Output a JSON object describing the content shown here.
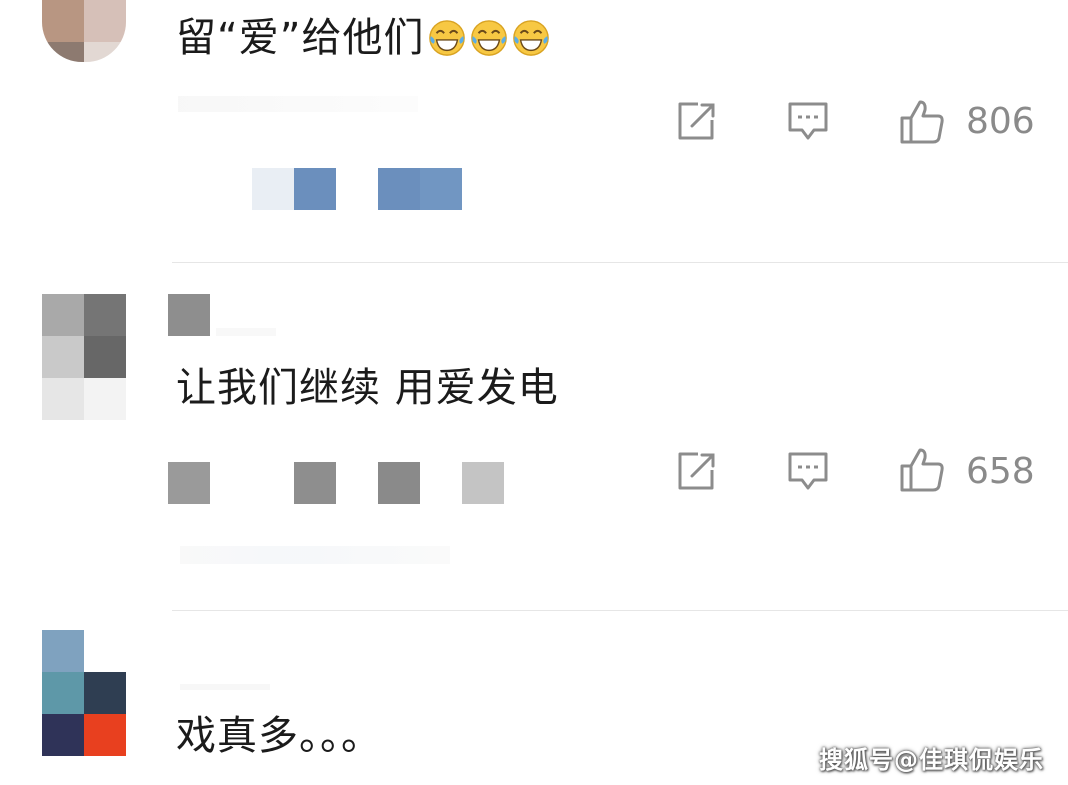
{
  "comments": [
    {
      "text": "留“爱”给他们",
      "emojis": [
        "laughing-tears-emoji",
        "laughing-tears-emoji",
        "laughing-tears-emoji"
      ],
      "likes": "806"
    },
    {
      "text": "让我们继续 用爱发电",
      "likes": "658"
    },
    {
      "text": "戏真多。。。"
    }
  ],
  "icons": {
    "share": "share-icon",
    "reply": "comment-icon",
    "like": "thumbs-up-icon"
  },
  "colors": {
    "icon_gray": "#8c8c8c",
    "text": "#1b1b1b",
    "count_gray": "#8a8a8a",
    "divider": "#e6e6e6",
    "mosaic_blue": "#6b8fbd"
  },
  "watermark": "搜狐号@佳琪侃娱乐"
}
